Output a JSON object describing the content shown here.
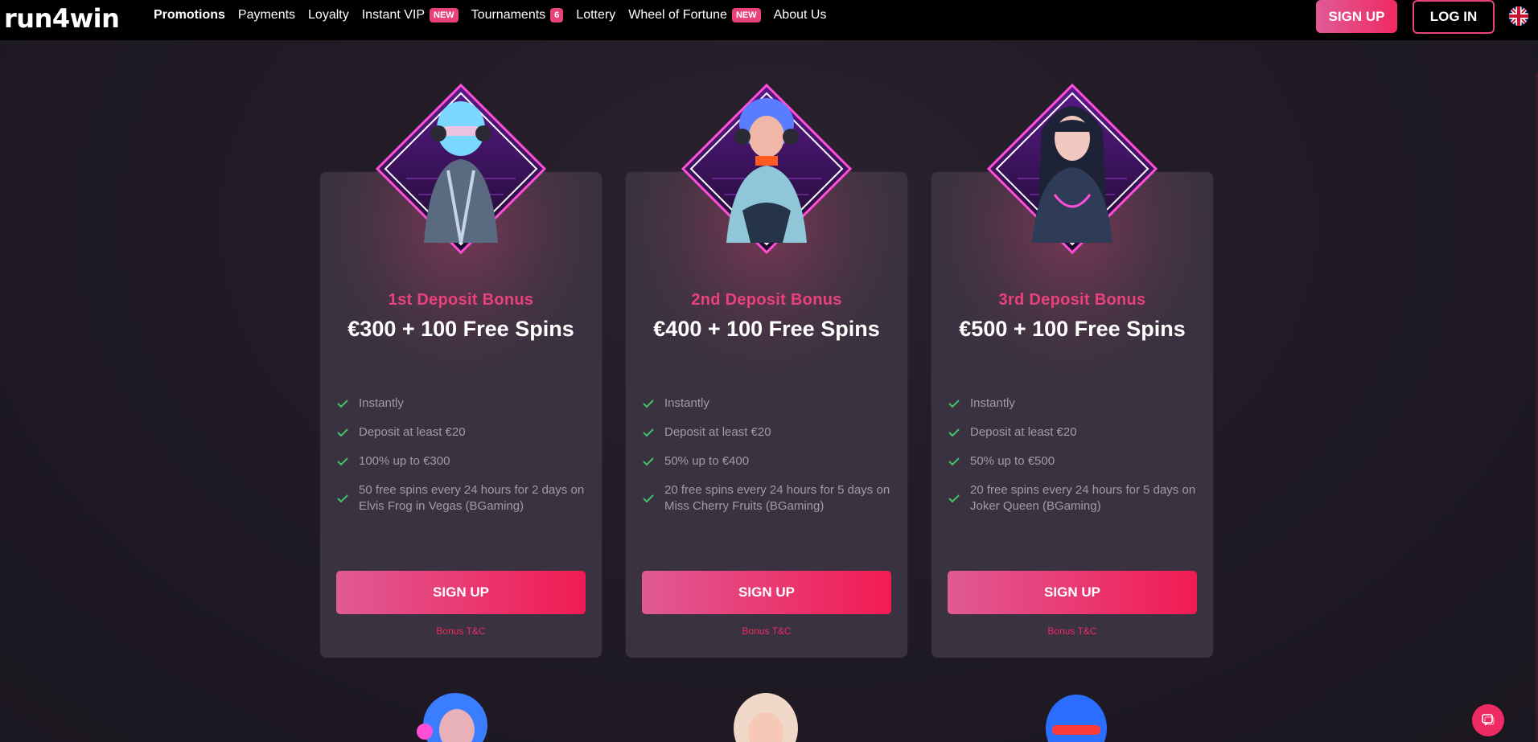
{
  "logo": "run4win",
  "nav": [
    {
      "label": "Promotions",
      "badge": null,
      "active": true
    },
    {
      "label": "Payments",
      "badge": null
    },
    {
      "label": "Loyalty",
      "badge": null
    },
    {
      "label": "Instant VIP",
      "badge": "NEW"
    },
    {
      "label": "Tournaments",
      "badge": "6"
    },
    {
      "label": "Lottery",
      "badge": null
    },
    {
      "label": "Wheel of Fortune",
      "badge": "NEW"
    },
    {
      "label": "About Us",
      "badge": null
    }
  ],
  "header": {
    "signup_label": "SIGN UP",
    "login_label": "LOG IN",
    "language_icon": "uk-flag-icon"
  },
  "colors": {
    "accent": "#e9417a",
    "check": "#3fc46a",
    "card_bg": "#3a3240"
  },
  "cards": [
    {
      "subtitle": "1st Deposit Bonus",
      "title": "€300 + 100 Free Spins",
      "features": [
        "Instantly",
        "Deposit at least €20",
        "100% up to €300",
        "50 free spins every 24 hours for 2 days on Elvis Frog in Vegas (BGaming)"
      ],
      "button": "SIGN UP",
      "tnc": "Bonus T&C"
    },
    {
      "subtitle": "2nd Deposit Bonus",
      "title": "€400 + 100 Free Spins",
      "features": [
        "Instantly",
        "Deposit at least €20",
        "50% up to €400",
        "20 free spins every 24 hours for 5 days on Miss Cherry Fruits (BGaming)"
      ],
      "button": "SIGN UP",
      "tnc": "Bonus T&C"
    },
    {
      "subtitle": "3rd Deposit Bonus",
      "title": "€500 + 100 Free Spins",
      "features": [
        "Instantly",
        "Deposit at least €20",
        "50% up to €500",
        "20 free spins every 24 hours for 5 days on Joker Queen (BGaming)"
      ],
      "button": "SIGN UP",
      "tnc": "Bonus T&C"
    }
  ],
  "chat_icon": "chat-icon"
}
